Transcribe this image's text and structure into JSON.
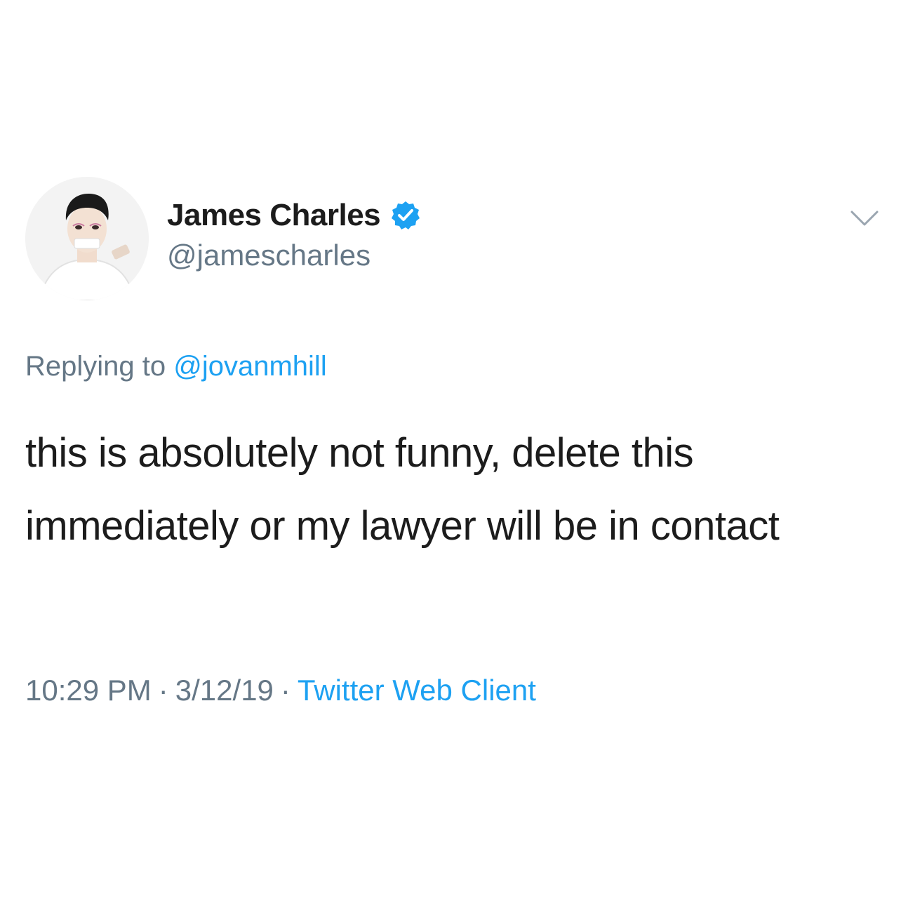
{
  "author": {
    "display_name": "James Charles",
    "handle": "@jamescharles",
    "verified": true,
    "avatar_icon": "profile-avatar"
  },
  "reply": {
    "prefix": "Replying to",
    "mention": "@jovanmhill"
  },
  "tweet": {
    "text": "this is absolutely not funny, delete this immediately or my lawyer will be in contact"
  },
  "meta": {
    "time": "10:29 PM",
    "separator": "·",
    "date": "3/12/19",
    "client": "Twitter Web Client"
  },
  "icons": {
    "verified": "verified-badge-icon",
    "more": "chevron-down-icon"
  },
  "colors": {
    "link_blue": "#1da1f2",
    "muted_gray": "#657786",
    "text_dark": "#1c1c1c"
  }
}
